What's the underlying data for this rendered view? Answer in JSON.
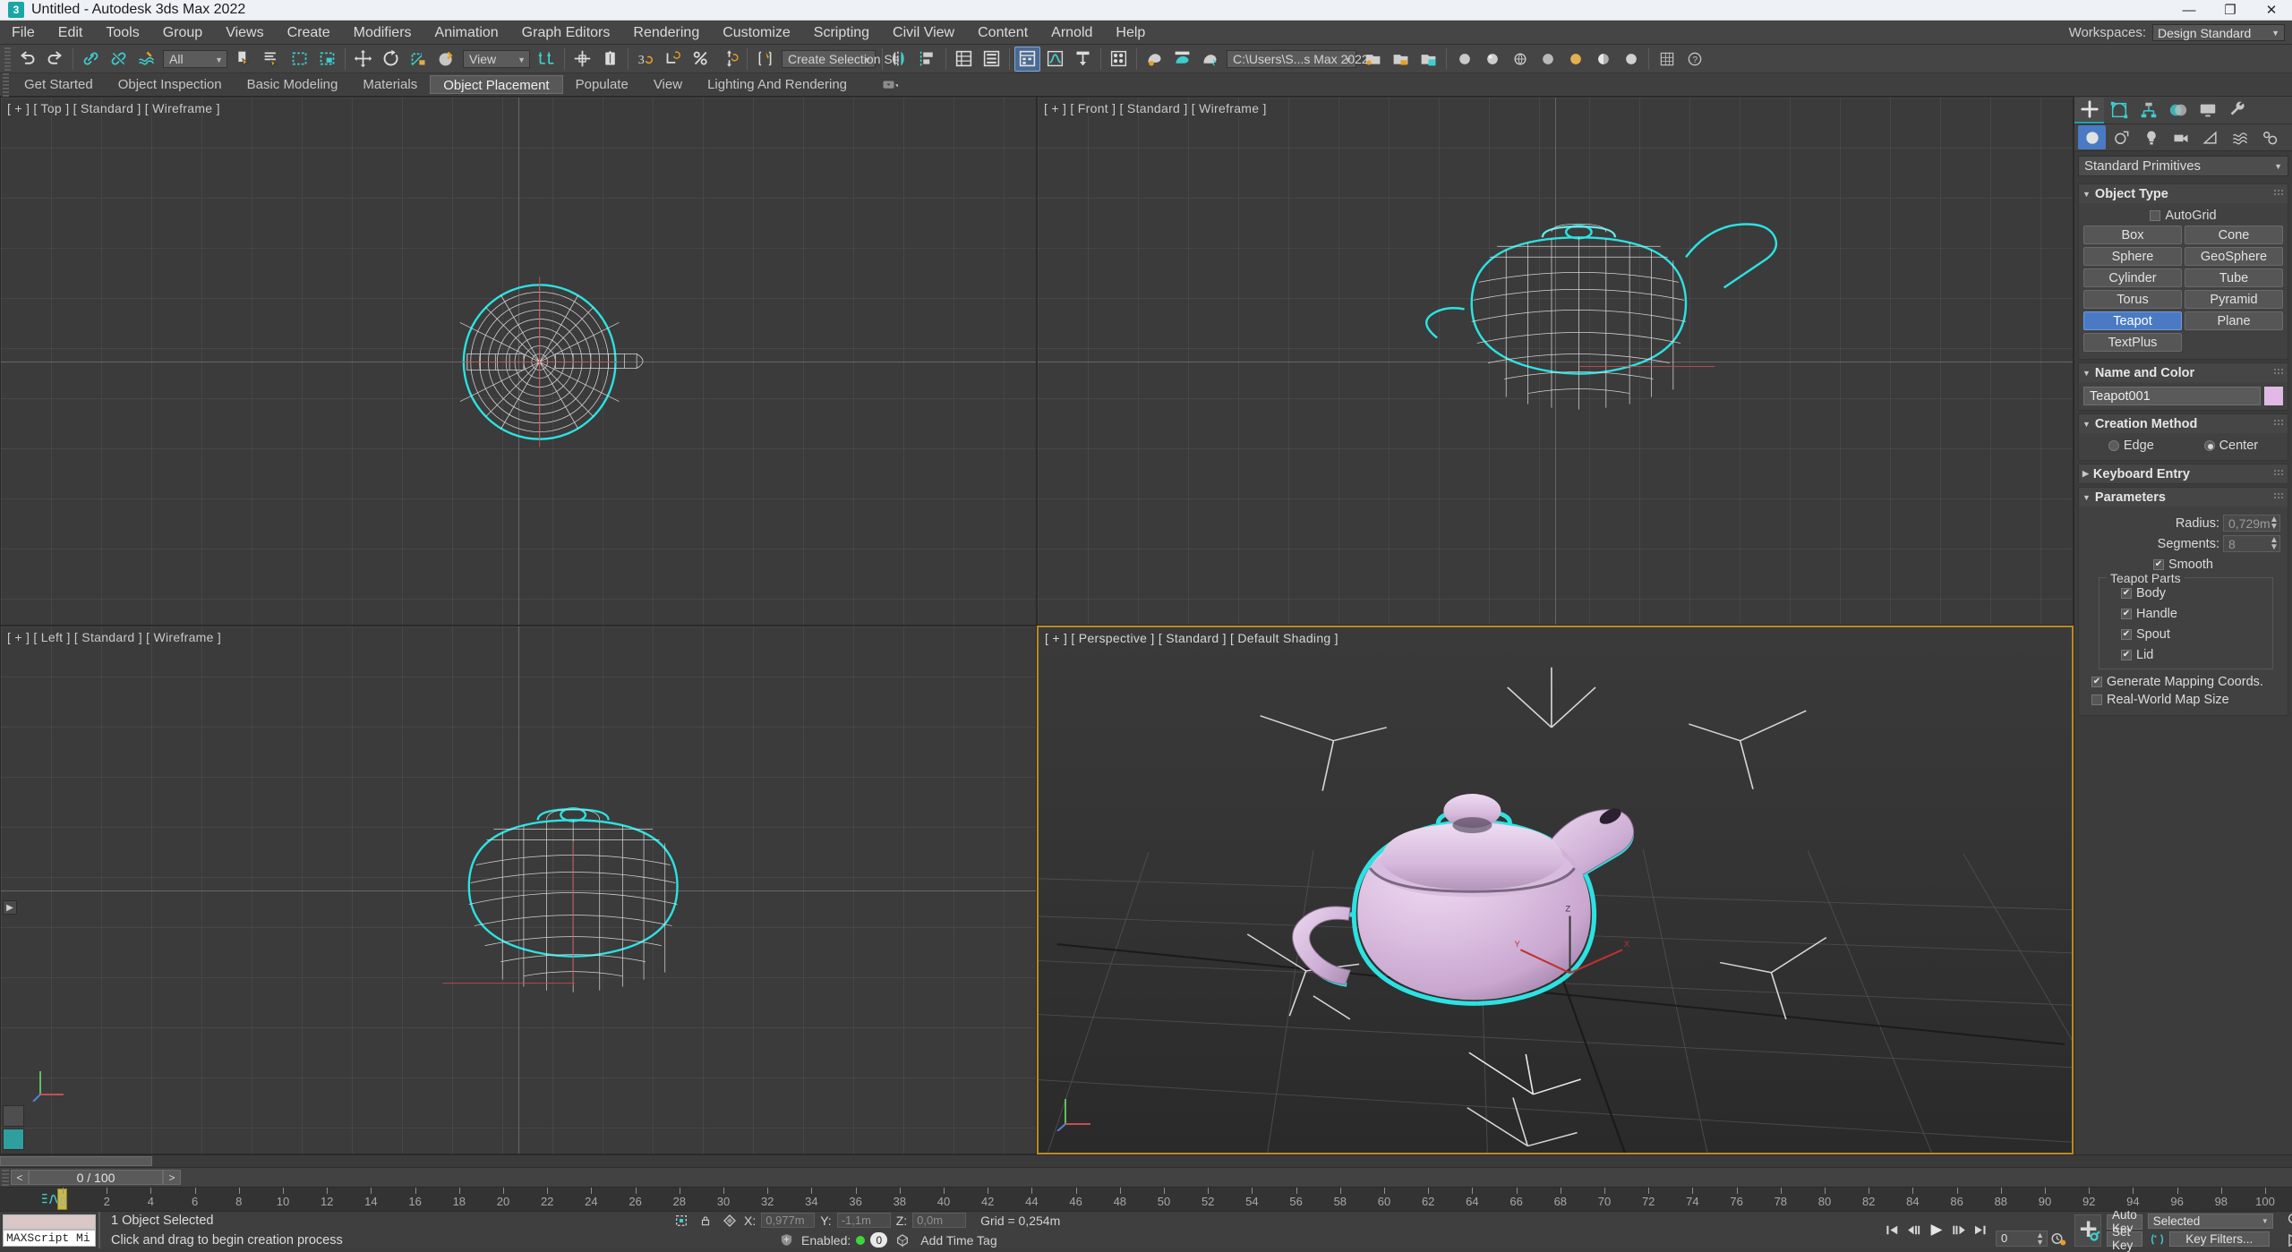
{
  "titlebar": {
    "app_icon": "3dsmax-icon",
    "title": "Untitled - Autodesk 3ds Max 2022",
    "minimize": "—",
    "restore": "❐",
    "close": "✕"
  },
  "menubar": {
    "items": [
      "File",
      "Edit",
      "Tools",
      "Group",
      "Views",
      "Create",
      "Modifiers",
      "Animation",
      "Graph Editors",
      "Rendering",
      "Customize",
      "Scripting",
      "Civil View",
      "Content",
      "Arnold",
      "Help"
    ],
    "workspaces_label": "Workspaces:",
    "workspaces_value": "Design Standard"
  },
  "toolbar": {
    "selection_filter": "All",
    "reference_coord": "View",
    "named_selection_sets": "Create Selection Se",
    "project_folder": "C:\\Users\\S...s Max 2022",
    "buttons": [
      "undo-icon",
      "redo-icon",
      "select-link-icon",
      "unlink-icon",
      "bind-space-warp-icon",
      "select-object-icon",
      "select-by-name-icon",
      "rectangular-region-icon",
      "window-crossing-icon",
      "select-and-move-icon",
      "select-and-rotate-icon",
      "select-and-scale-icon",
      "select-and-place-icon",
      "use-center-icon",
      "align-icon",
      "mirror-icon",
      "angle-snap-icon",
      "percent-snap-icon",
      "spinner-snap-icon",
      "snaps-toggle-icon",
      "edit-named-selection-icon",
      "mirror-tool-icon",
      "align-tool-icon",
      "layer-explorer-icon",
      "scene-explorer-icon",
      "curve-editor-icon",
      "schematic-view-icon",
      "material-editor-icon",
      "render-setup-icon",
      "render-frame-icon",
      "render-production-icon"
    ]
  },
  "ribbon": {
    "tabs": [
      "Get Started",
      "Object Inspection",
      "Basic Modeling",
      "Materials",
      "Object Placement",
      "Populate",
      "View",
      "Lighting And Rendering"
    ],
    "selected": "Object Placement",
    "overflow": "▾"
  },
  "viewports": [
    {
      "id": "top",
      "label": "[ + ] [ Top ] [ Standard ] [ Wireframe ]"
    },
    {
      "id": "front",
      "label": "[ + ] [ Front ] [ Standard ] [ Wireframe ]"
    },
    {
      "id": "left",
      "label": "[ + ] [ Left ] [ Standard ] [ Wireframe ]"
    },
    {
      "id": "persp",
      "label": "[ + ] [ Perspective ] [ Standard ] [ Default Shading ]"
    }
  ],
  "command_panel": {
    "tabs": [
      "create-tab",
      "modify-tab",
      "hierarchy-tab",
      "motion-tab",
      "display-tab",
      "utilities-tab"
    ],
    "selected_tab": "create-tab",
    "categories": [
      "geometry-category",
      "shapes-category",
      "lights-category",
      "cameras-category",
      "helpers-category",
      "space-warps-category",
      "systems-category"
    ],
    "selected_category": "geometry-category",
    "subcategory": "Standard Primitives",
    "object_type": {
      "title": "Object Type",
      "autogrid_label": "AutoGrid",
      "autogrid_checked": false,
      "buttons": [
        "Box",
        "Cone",
        "Sphere",
        "GeoSphere",
        "Cylinder",
        "Tube",
        "Torus",
        "Pyramid",
        "Teapot",
        "Plane",
        "TextPlus"
      ],
      "selected_button": "Teapot"
    },
    "name_and_color": {
      "title": "Name and Color",
      "name": "Teapot001",
      "color": "#e3b8e8"
    },
    "creation_method": {
      "title": "Creation Method",
      "options": [
        "Edge",
        "Center"
      ],
      "selected": "Center"
    },
    "keyboard_entry": {
      "title": "Keyboard Entry",
      "expanded": false
    },
    "parameters": {
      "title": "Parameters",
      "radius_label": "Radius:",
      "radius_value": "0,729m",
      "segments_label": "Segments:",
      "segments_value": "8",
      "smooth_label": "Smooth",
      "smooth_checked": true,
      "teapot_parts_title": "Teapot Parts",
      "parts": [
        {
          "label": "Body",
          "checked": true
        },
        {
          "label": "Handle",
          "checked": true
        },
        {
          "label": "Spout",
          "checked": true
        },
        {
          "label": "Lid",
          "checked": true
        }
      ],
      "gen_mapping_label": "Generate Mapping Coords.",
      "gen_mapping_checked": true,
      "real_world_label": "Real-World Map Size",
      "real_world_checked": false
    }
  },
  "timeline": {
    "prev_frame": "<",
    "next_frame": ">",
    "frame_display": "0 / 100",
    "tick_labels": [
      "0",
      "2",
      "4",
      "6",
      "8",
      "10",
      "12",
      "14",
      "16",
      "18",
      "20",
      "22",
      "24",
      "26",
      "28",
      "30",
      "32",
      "34",
      "36",
      "38",
      "40",
      "42",
      "44",
      "46",
      "48",
      "50",
      "52",
      "54",
      "56",
      "58",
      "60",
      "62",
      "64",
      "66",
      "68",
      "70",
      "72",
      "74",
      "76",
      "78",
      "80",
      "82",
      "84",
      "86",
      "88",
      "90",
      "92",
      "94",
      "96",
      "98",
      "100"
    ]
  },
  "statusbar": {
    "maxscript_mini_listener": "MAXScript Mi",
    "selection_status": "1 Object Selected",
    "prompt": "Click and drag to begin creation process",
    "x_label": "X:",
    "x_value": "0,977m",
    "y_label": "Y:",
    "y_value": "-1,1m",
    "z_label": "Z:",
    "z_value": "0,0m",
    "grid_text": "Grid = 0,254m",
    "enabled_label": "Enabled:",
    "enabled_value": "0",
    "add_time_tag": "Add Time Tag",
    "auto_key": "Auto Key",
    "set_key": "Set Key",
    "key_mode": "Selected",
    "key_filters": "Key Filters...",
    "current_frame": "0",
    "nav_buttons": [
      "zoom-icon",
      "zoom-all-icon",
      "zoom-extents-icon",
      "zoom-region-icon",
      "field-of-view-icon",
      "pan-icon",
      "orbit-icon",
      "maximize-viewport-icon"
    ],
    "playback_buttons": [
      "goto-start-icon",
      "previous-frame-icon",
      "play-icon",
      "next-frame-icon",
      "goto-end-icon"
    ]
  },
  "colors": {
    "accent_select": "#4a7ac4",
    "teapot_body": "#d4b6d8",
    "selection_outline": "#2ce2e2",
    "active_viewport_border": "#b98a23",
    "teal": "#1ba6a6"
  }
}
